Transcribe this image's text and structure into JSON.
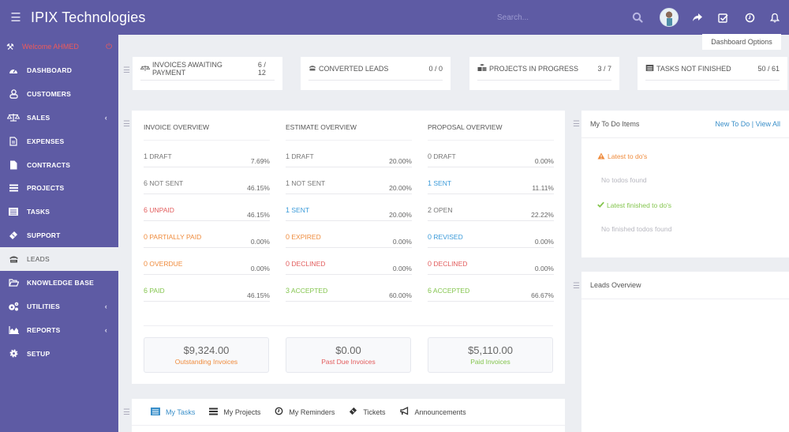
{
  "app": {
    "title": "IPIX Technologies"
  },
  "topbar": {
    "search_placeholder": "Search...",
    "icons": [
      "search-icon",
      "avatar",
      "share-icon",
      "checkbox-icon",
      "clock-icon",
      "bell-icon"
    ]
  },
  "sidebar": {
    "welcome": "Welcome AHMED",
    "items": [
      {
        "label": "DASHBOARD",
        "icon": "dashboard-icon"
      },
      {
        "label": "CUSTOMERS",
        "icon": "user-icon"
      },
      {
        "label": "SALES",
        "icon": "balance-scale-icon",
        "has_children": true
      },
      {
        "label": "EXPENSES",
        "icon": "file-invoice-icon"
      },
      {
        "label": "CONTRACTS",
        "icon": "file-icon"
      },
      {
        "label": "PROJECTS",
        "icon": "bars-icon"
      },
      {
        "label": "TASKS",
        "icon": "tasks-icon"
      },
      {
        "label": "SUPPORT",
        "icon": "ticket-icon"
      },
      {
        "label": "LEADS",
        "icon": "tty-icon",
        "active": true
      },
      {
        "label": "KNOWLEDGE BASE",
        "icon": "folder-open-icon"
      },
      {
        "label": "UTILITIES",
        "icon": "cogs-icon",
        "has_children": true
      },
      {
        "label": "REPORTS",
        "icon": "area-chart-icon",
        "has_children": true
      },
      {
        "label": "SETUP",
        "icon": "cog-icon"
      }
    ]
  },
  "dashboard_options": "Dashboard Options",
  "stats": [
    {
      "label": "INVOICES AWAITING PAYMENT",
      "value": "6 / 12",
      "icon": "balance-scale-icon"
    },
    {
      "label": "CONVERTED LEADS",
      "value": "0 / 0",
      "icon": "tty-icon"
    },
    {
      "label": "PROJECTS IN PROGRESS",
      "value": "3 / 7",
      "icon": "cubes-icon"
    },
    {
      "label": "TASKS NOT FINISHED",
      "value": "50 / 61",
      "icon": "tasks-icon"
    }
  ],
  "overview": {
    "columns": [
      {
        "title": "INVOICE OVERVIEW",
        "rows": [
          {
            "count": "1",
            "label": "DRAFT",
            "pct": "7.69%",
            "color": "#777777"
          },
          {
            "count": "6",
            "label": "NOT SENT",
            "pct": "46.15%",
            "color": "#777777"
          },
          {
            "count": "6",
            "label": "UNPAID",
            "pct": "46.15%",
            "color": "#e25c5c"
          },
          {
            "count": "0",
            "label": "PARTIALLY PAID",
            "pct": "0.00%",
            "color": "#ef8b3c"
          },
          {
            "count": "0",
            "label": "OVERDUE",
            "pct": "0.00%",
            "color": "#ef8b3c"
          },
          {
            "count": "6",
            "label": "PAID",
            "pct": "46.15%",
            "color": "#84c54e"
          }
        ]
      },
      {
        "title": "ESTIMATE OVERVIEW",
        "rows": [
          {
            "count": "1",
            "label": "DRAFT",
            "pct": "20.00%",
            "color": "#777777"
          },
          {
            "count": "1",
            "label": "NOT SENT",
            "pct": "20.00%",
            "color": "#777777"
          },
          {
            "count": "1",
            "label": "SENT",
            "pct": "20.00%",
            "color": "#3a9ad9"
          },
          {
            "count": "0",
            "label": "EXPIRED",
            "pct": "0.00%",
            "color": "#ef8b3c"
          },
          {
            "count": "0",
            "label": "DECLINED",
            "pct": "0.00%",
            "color": "#e25c5c"
          },
          {
            "count": "3",
            "label": "ACCEPTED",
            "pct": "60.00%",
            "color": "#84c54e"
          }
        ]
      },
      {
        "title": "PROPOSAL OVERVIEW",
        "rows": [
          {
            "count": "0",
            "label": "DRAFT",
            "pct": "0.00%",
            "color": "#777777"
          },
          {
            "count": "1",
            "label": "SENT",
            "pct": "11.11%",
            "color": "#3a9ad9"
          },
          {
            "count": "2",
            "label": "OPEN",
            "pct": "22.22%",
            "color": "#777777"
          },
          {
            "count": "0",
            "label": "REVISED",
            "pct": "0.00%",
            "color": "#3a9ad9"
          },
          {
            "count": "0",
            "label": "DECLINED",
            "pct": "0.00%",
            "color": "#e25c5c"
          },
          {
            "count": "6",
            "label": "ACCEPTED",
            "pct": "66.67%",
            "color": "#84c54e"
          }
        ]
      }
    ],
    "totals": [
      {
        "amount": "$9,324.00",
        "caption": "Outstanding Invoices",
        "color": "#ef8b3c"
      },
      {
        "amount": "$0.00",
        "caption": "Past Due Invoices",
        "color": "#e25c5c"
      },
      {
        "amount": "$5,110.00",
        "caption": "Paid Invoices",
        "color": "#84c54e"
      }
    ]
  },
  "todo": {
    "title": "My To Do Items",
    "new_link": "New To Do",
    "view_all_link": "| View All",
    "latest_header": "Latest to do's",
    "latest_empty": "No todos found",
    "finished_header": "Latest finished to do's",
    "finished_empty": "No finished todos found",
    "warning_color": "#ef8b3c",
    "success_color": "#84c54e"
  },
  "leads_overview": {
    "title": "Leads Overview"
  },
  "tabs": [
    {
      "label": "My Tasks",
      "icon": "tasks-icon",
      "active": true
    },
    {
      "label": "My Projects",
      "icon": "bars-icon"
    },
    {
      "label": "My Reminders",
      "icon": "clock-icon"
    },
    {
      "label": "Tickets",
      "icon": "ticket-icon"
    },
    {
      "label": "Announcements",
      "icon": "bullhorn-icon"
    }
  ]
}
